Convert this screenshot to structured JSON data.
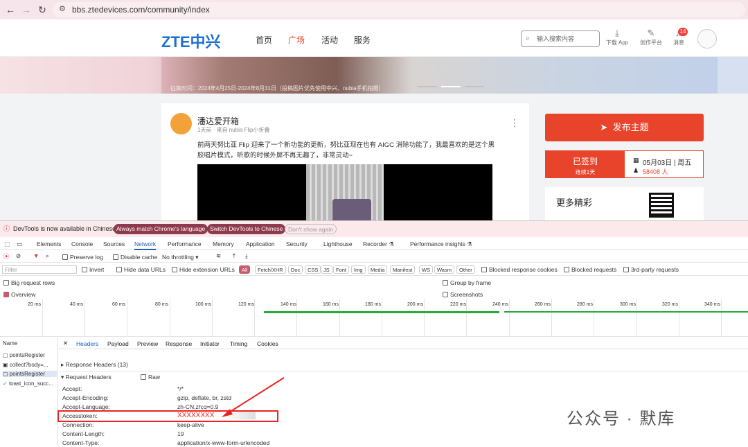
{
  "browser": {
    "url": "bbs.ztedevices.com/community/index"
  },
  "site": {
    "logo": "ZTE中兴",
    "nav": [
      "首页",
      "广场",
      "活动",
      "服务"
    ],
    "search_placeholder": "输入搜索内容",
    "icons": [
      {
        "label": "下载 App"
      },
      {
        "label": "创作平台"
      },
      {
        "label": "消息"
      }
    ],
    "message_count": "14",
    "banner_text": "征集时间：2024年4月25日-2024年8月31日（投稿图片优先使用中兴、nubia手机拍摄）"
  },
  "post": {
    "author": "潘达爱开箱",
    "meta": "1天前 · 来自 nubia Flip小折叠",
    "body": "前两天努比亚 Flip 迎来了一个新功能的更新，努比亚现在也有 AIGC 消除功能了，我最喜欢的是这个黑胶唱片模式，听歌的时候外屏不再无趣了，非常灵动~"
  },
  "sidebar": {
    "publish_label": "发布主题",
    "checked_in": "已签到",
    "streak": "连续1天",
    "date": "05月03日 | 周五",
    "count": "58408 人",
    "more_title": "更多精彩"
  },
  "devtools": {
    "infobar": {
      "message": "DevTools is now available in Chinese!",
      "btn1": "Always match Chrome's language",
      "btn2": "Switch DevTools to Chinese",
      "btn3": "Don't show again"
    },
    "tabs": [
      "Elements",
      "Console",
      "Sources",
      "Network",
      "Performance",
      "Memory",
      "Application",
      "Security",
      "Lighthouse",
      "Recorder ⚗",
      "Performance insights ⚗"
    ],
    "toolbar": {
      "preserve_log": "Preserve log",
      "disable_cache": "Disable cache",
      "throttling": "No throttling"
    },
    "filter": {
      "placeholder": "Filter",
      "invert": "Invert",
      "hide_data": "Hide data URLs",
      "hide_ext": "Hide extension URLs",
      "types": [
        "All",
        "Fetch/XHR",
        "Doc",
        "CSS",
        "JS",
        "Font",
        "Img",
        "Media",
        "Manifest",
        "WS",
        "Wasm",
        "Other"
      ],
      "blocked_cookies": "Blocked response cookies",
      "blocked_requests": "Blocked requests",
      "third_party": "3rd-party requests"
    },
    "options": {
      "big_rows": "Big request rows",
      "group_by_frame": "Group by frame",
      "overview": "Overview",
      "screenshots": "Screenshots"
    },
    "ticks": [
      "20 ms",
      "40 ms",
      "60 ms",
      "80 ms",
      "100 ms",
      "120 ms",
      "140 ms",
      "160 ms",
      "180 ms",
      "200 ms",
      "220 ms",
      "240 ms",
      "260 ms",
      "280 ms",
      "300 ms",
      "320 ms",
      "340 ms"
    ],
    "name_header": "Name",
    "requests": [
      "pointsRegister",
      "collect?body=...",
      "pointsRegister",
      "toast_icon_succ..."
    ],
    "detail_tabs": [
      "Headers",
      "Payload",
      "Preview",
      "Response",
      "Initiator",
      "Timing",
      "Cookies"
    ],
    "response_headers": "▸ Response Headers (13)",
    "request_headers": "▾ Request Headers",
    "raw": "Raw",
    "headers": [
      {
        "name": "Accept:",
        "value": "*/*"
      },
      {
        "name": "Accept-Encoding:",
        "value": "gzip, deflate, br, zstd"
      },
      {
        "name": "Accept-Language:",
        "value": "zh-CN,zh;q=0.9"
      },
      {
        "name": "Accesstoken:",
        "value": "XXXXXXXX"
      },
      {
        "name": "Connection:",
        "value": "keep-alive"
      },
      {
        "name": "Content-Length:",
        "value": "19"
      },
      {
        "name": "Content-Type:",
        "value": "application/x-www-form-urlencoded"
      }
    ]
  },
  "watermark": "公众号 · 默库"
}
